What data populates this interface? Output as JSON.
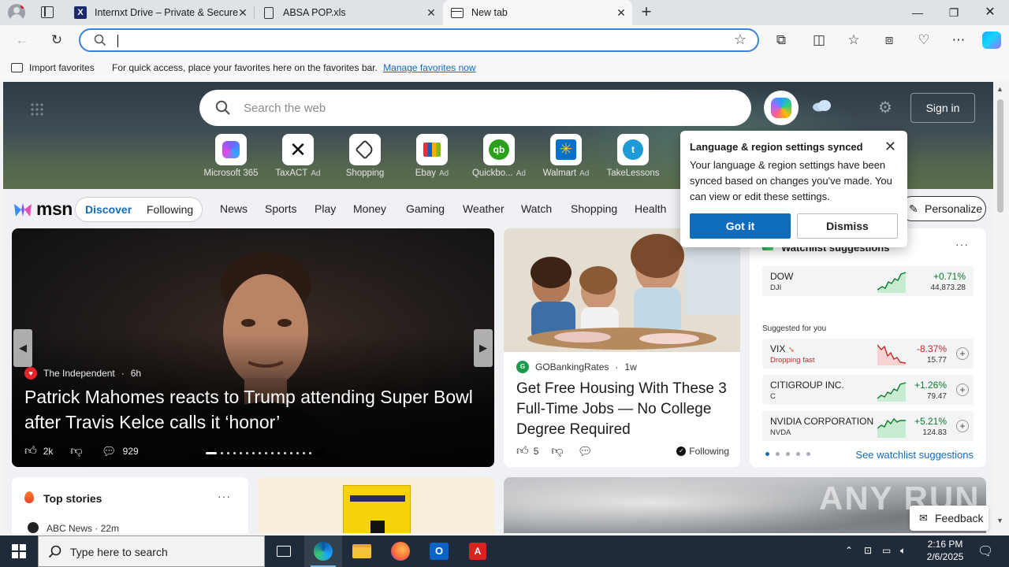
{
  "tabs": [
    {
      "title": "Internxt Drive – Private & Secure",
      "icon": "internxt-icon"
    },
    {
      "title": "ABSA POP.xls",
      "icon": "document-icon"
    },
    {
      "title": "New tab",
      "icon": "newtab-icon",
      "active": true
    }
  ],
  "address_bar": {
    "value": "",
    "placeholder": ""
  },
  "favorites_bar": {
    "import_label": "Import favorites",
    "hint": "For quick access, place your favorites here on the favorites bar.",
    "manage_link": "Manage favorites now"
  },
  "newtab": {
    "search_placeholder": "Search the web",
    "sign_in": "Sign in",
    "quick_links": [
      {
        "label": "Microsoft 365",
        "ad": ""
      },
      {
        "label": "TaxACT",
        "ad": "Ad"
      },
      {
        "label": "Shopping",
        "ad": ""
      },
      {
        "label": "Ebay",
        "ad": "Ad"
      },
      {
        "label": "Quickbo...",
        "ad": "Ad"
      },
      {
        "label": "Walmart",
        "ad": "Ad"
      },
      {
        "label": "TakeLessons",
        "ad": ""
      }
    ]
  },
  "msn": {
    "logo": "msn",
    "feed_tabs": [
      "Discover",
      "Following"
    ],
    "nav": [
      "News",
      "Sports",
      "Play",
      "Money",
      "Gaming",
      "Weather",
      "Watch",
      "Shopping",
      "Health"
    ],
    "personalize": "Personalize"
  },
  "main_story": {
    "source": "The Independent",
    "age": "6h",
    "headline": "Patrick Mahomes reacts to Trump attending Super Bowl after Travis Kelce calls it ‘honor’",
    "likes": "2k",
    "comments": "929"
  },
  "story2": {
    "source": "GOBankingRates",
    "age": "1w",
    "headline": "Get Free Housing With These 3 Full-Time Jobs — No College Degree Required",
    "likes": "5",
    "following": "Following"
  },
  "watchlist": {
    "title": "Watchlist suggestions",
    "suggested_label": "Suggested for you",
    "see_all": "See watchlist suggestions",
    "stocks": [
      {
        "name": "DOW",
        "ticker": "DJI",
        "change": "+0.71%",
        "price": "44,873.28",
        "color": "#0a7d2a",
        "note": ""
      },
      {
        "name": "VIX",
        "ticker": "",
        "change": "-8.37%",
        "price": "15.77",
        "color": "#c62828",
        "note": "Dropping fast"
      },
      {
        "name": "CITIGROUP INC.",
        "ticker": "C",
        "change": "+1.26%",
        "price": "79.47",
        "color": "#0a7d2a",
        "note": ""
      },
      {
        "name": "NVIDIA CORPORATION",
        "ticker": "NVDA",
        "change": "+5.21%",
        "price": "124.83",
        "color": "#0a7d2a",
        "note": ""
      }
    ]
  },
  "popup": {
    "title": "Language & region settings synced",
    "body": "Your language & region settings have been synced based on changes you've made. You can view or edit these settings.",
    "got_it": "Got it",
    "dismiss": "Dismiss"
  },
  "top_stories": {
    "title": "Top stories",
    "first_source": "ABC News · 22m"
  },
  "feedback": "Feedback",
  "watermark": "ANY RUN",
  "taskbar": {
    "search_placeholder": "Type here to search",
    "time": "2:16 PM",
    "date": "2/6/2025"
  }
}
